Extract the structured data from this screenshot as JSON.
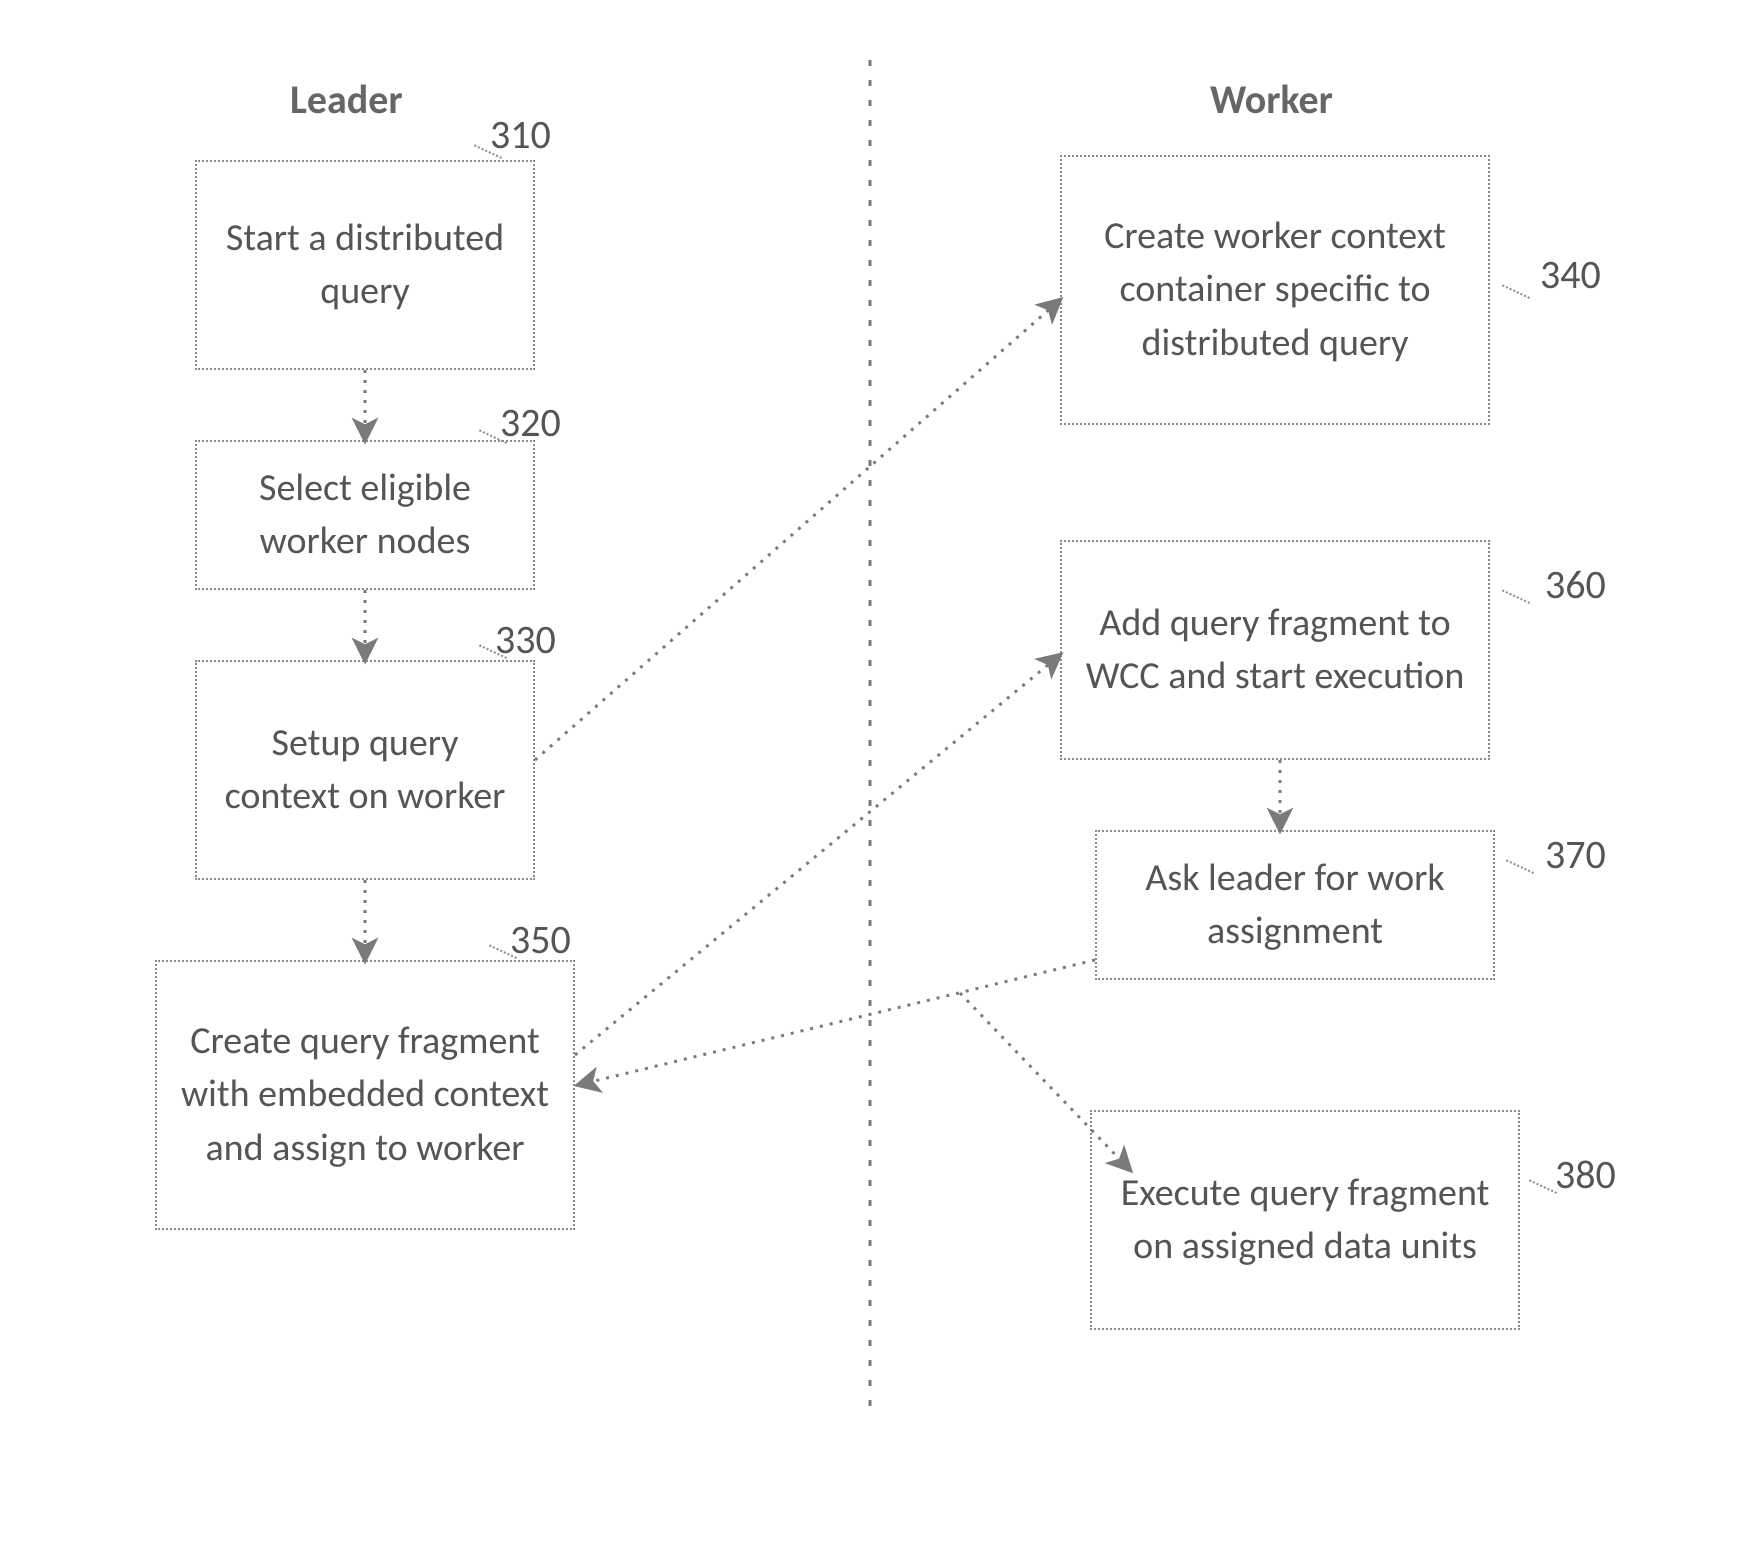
{
  "titles": {
    "leader": "Leader",
    "worker": "Worker"
  },
  "boxes": {
    "b310": {
      "ref": "310",
      "text": "Start a distributed query"
    },
    "b320": {
      "ref": "320",
      "text": "Select eligible worker nodes"
    },
    "b330": {
      "ref": "330",
      "text": "Setup query context on worker"
    },
    "b350": {
      "ref": "350",
      "text": "Create query fragment with embedded context and assign to worker"
    },
    "b340": {
      "ref": "340",
      "text": "Create worker context container specific to distributed query"
    },
    "b360": {
      "ref": "360",
      "text": "Add query fragment to WCC and start execution"
    },
    "b370": {
      "ref": "370",
      "text": "Ask leader for work assignment"
    },
    "b380": {
      "ref": "380",
      "text": "Execute query fragment on assigned data units"
    }
  },
  "edges": [
    {
      "from": "b310",
      "to": "b320"
    },
    {
      "from": "b320",
      "to": "b330"
    },
    {
      "from": "b330",
      "to": "b350"
    },
    {
      "from": "b330",
      "to": "b340"
    },
    {
      "from": "b350",
      "to": "b360"
    },
    {
      "from": "b360",
      "to": "b370"
    },
    {
      "from": "b370",
      "to": "b350"
    },
    {
      "from": "b370",
      "to": "b380"
    }
  ]
}
